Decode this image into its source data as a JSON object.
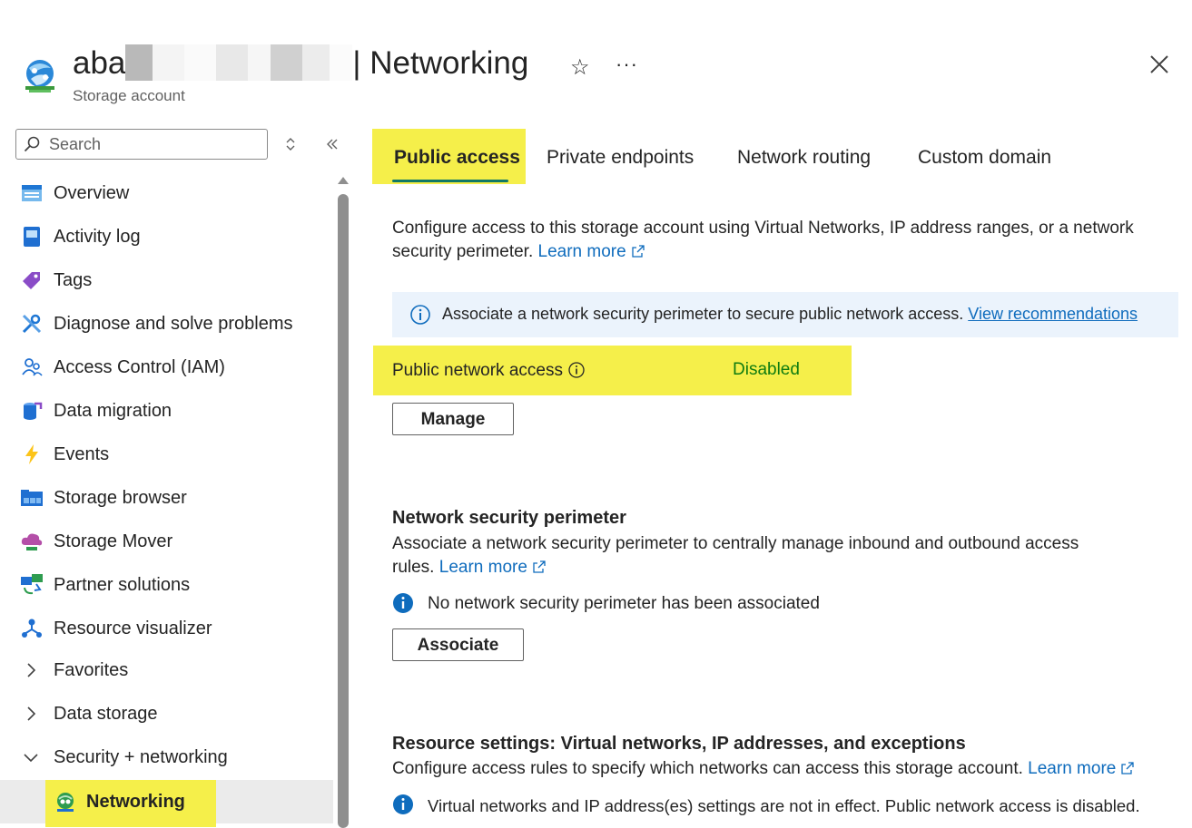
{
  "header": {
    "title_prefix": "aba",
    "title_suffix": "| Networking",
    "subtitle": "Storage account"
  },
  "sidebar": {
    "search_placeholder": "Search",
    "items": [
      {
        "label": "Overview",
        "icon": "overview-icon"
      },
      {
        "label": "Activity log",
        "icon": "activity-log-icon"
      },
      {
        "label": "Tags",
        "icon": "tag-icon"
      },
      {
        "label": "Diagnose and solve problems",
        "icon": "wrench-icon"
      },
      {
        "label": "Access Control (IAM)",
        "icon": "people-icon"
      },
      {
        "label": "Data migration",
        "icon": "data-migration-icon"
      },
      {
        "label": "Events",
        "icon": "lightning-icon"
      },
      {
        "label": "Storage browser",
        "icon": "storage-browser-icon"
      },
      {
        "label": "Storage Mover",
        "icon": "cloud-icon"
      },
      {
        "label": "Partner solutions",
        "icon": "partner-icon"
      },
      {
        "label": "Resource visualizer",
        "icon": "hierarchy-icon"
      },
      {
        "label": "Favorites",
        "icon": "chevron-right-icon"
      },
      {
        "label": "Data storage",
        "icon": "chevron-right-icon"
      },
      {
        "label": "Security + networking",
        "icon": "chevron-down-icon"
      },
      {
        "label": "Networking",
        "icon": "networking-icon"
      }
    ]
  },
  "tabs": [
    {
      "label": "Public access",
      "active": true
    },
    {
      "label": "Private endpoints",
      "active": false
    },
    {
      "label": "Network routing",
      "active": false
    },
    {
      "label": "Custom domain",
      "active": false
    }
  ],
  "main": {
    "intro_text": "Configure access to this storage account using Virtual Networks, IP address ranges, or a network security perimeter.",
    "intro_link": "Learn more",
    "banner_text": "Associate a network security perimeter to secure public network access.",
    "banner_link": "View recommendations",
    "public_network_access_label": "Public network access",
    "public_network_access_value": "Disabled",
    "manage_button": "Manage",
    "nsp_heading": "Network security perimeter",
    "nsp_text": "Associate a network security perimeter to centrally manage inbound and outbound access rules.",
    "nsp_link": "Learn more",
    "nsp_status": "No network security perimeter has been associated",
    "associate_button": "Associate",
    "rs_heading": "Resource settings: Virtual networks, IP addresses, and exceptions",
    "rs_text": "Configure access rules to specify which networks can access this storage account.",
    "rs_link": "Learn more",
    "rs_status": "Virtual networks and IP address(es) settings are not in effect. Public network access is disabled."
  },
  "colors": {
    "highlight": "#f5ef4a",
    "link": "#0f6cbd",
    "status_green": "#107c10",
    "tab_underline": "#117865",
    "banner_bg": "#ebf3fc"
  }
}
